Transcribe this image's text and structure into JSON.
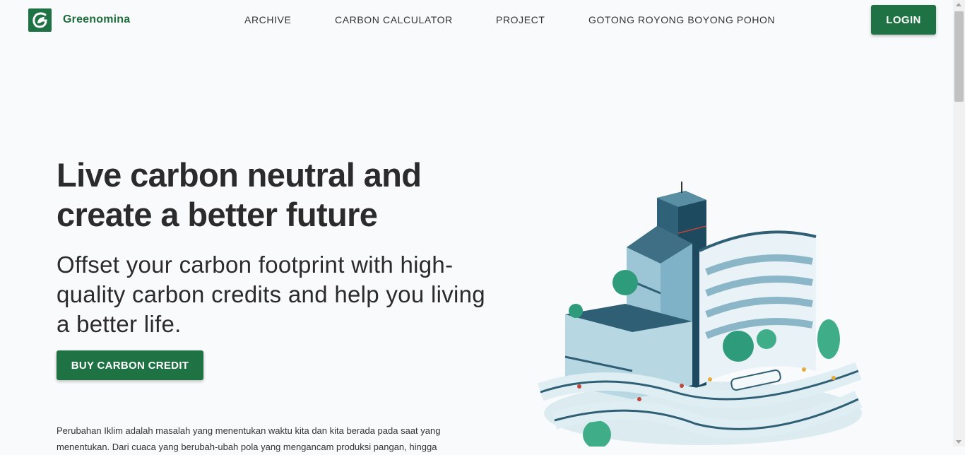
{
  "header": {
    "brand": "Greenomina",
    "nav": [
      "ARCHIVE",
      "CARBON CALCULATOR",
      "PROJECT",
      "GOTONG ROYONG BOYONG POHON"
    ],
    "login_label": "LOGIN"
  },
  "hero": {
    "title": "Live carbon neutral and create a better future",
    "subtitle": "Offset your carbon footprint with high-quality carbon credits and help you living a better life.",
    "cta_label": "BUY CARBON CREDIT",
    "body": "Perubahan Iklim adalah masalah yang menentukan waktu kita dan kita berada pada saat yang menentukan. Dari cuaca yang berubah-ubah pola yang mengancam produksi pangan, hingga"
  },
  "icons": {
    "logo": "leaf-g-logo-icon",
    "illustration": "green-city-buildings-illustration"
  },
  "colors": {
    "brand": "#1e7243",
    "brand_text": "#1e6b3c",
    "background": "#f9fafb",
    "heading": "#2b2b2b"
  }
}
